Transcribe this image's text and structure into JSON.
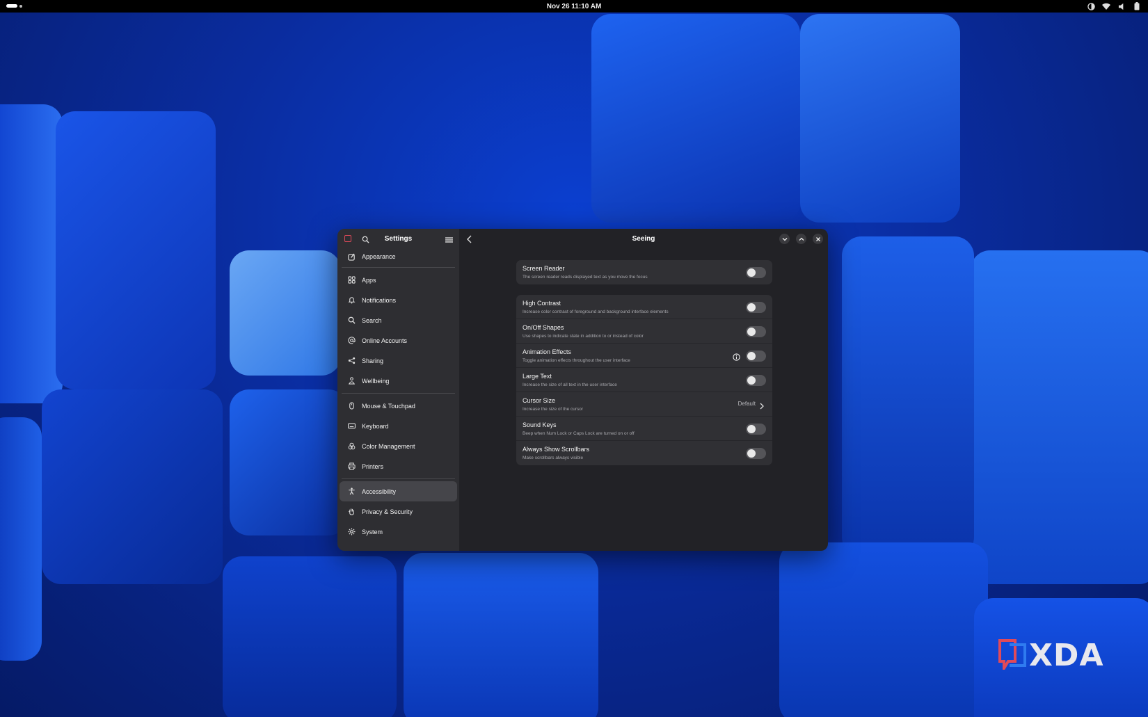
{
  "topbar": {
    "clock": "Nov 26  11:10 AM",
    "tray_icons": [
      "night-light-icon",
      "wifi-icon",
      "volume-icon",
      "battery-icon"
    ]
  },
  "window": {
    "sidebar": {
      "title": "Settings",
      "items": [
        {
          "label": "Appearance",
          "icon": "appearance-icon"
        },
        {
          "label": "Apps",
          "icon": "apps-grid-icon"
        },
        {
          "label": "Notifications",
          "icon": "bell-icon"
        },
        {
          "label": "Search",
          "icon": "search-icon"
        },
        {
          "label": "Online Accounts",
          "icon": "at-icon"
        },
        {
          "label": "Sharing",
          "icon": "share-icon"
        },
        {
          "label": "Wellbeing",
          "icon": "wellbeing-icon"
        },
        {
          "label": "Mouse & Touchpad",
          "icon": "mouse-icon"
        },
        {
          "label": "Keyboard",
          "icon": "keyboard-icon"
        },
        {
          "label": "Color Management",
          "icon": "color-icon"
        },
        {
          "label": "Printers",
          "icon": "printer-icon"
        },
        {
          "label": "Accessibility",
          "icon": "accessibility-icon",
          "active": true
        },
        {
          "label": "Privacy & Security",
          "icon": "hand-icon"
        },
        {
          "label": "System",
          "icon": "gear-icon"
        }
      ]
    },
    "main": {
      "title": "Seeing",
      "screen_reader": {
        "title": "Screen Reader",
        "subtitle": "The screen reader reads displayed text as you move the focus",
        "enabled": false
      },
      "settings": [
        {
          "title": "High Contrast",
          "subtitle": "Increase color contrast of foreground and background interface elements",
          "enabled": false
        },
        {
          "title": "On/Off Shapes",
          "subtitle": "Use shapes to indicate state in addition to or instead of color",
          "enabled": false
        },
        {
          "title": "Animation Effects",
          "subtitle": "Toggle animation effects throughout the user interface",
          "enabled": false
        },
        {
          "title": "Large Text",
          "subtitle": "Increase the size of all text in the user interface",
          "enabled": false
        },
        {
          "title": "Cursor Size",
          "subtitle": "Increase the size of the cursor",
          "value": "Default"
        },
        {
          "title": "Sound Keys",
          "subtitle": "Beep when Num Lock or Caps Lock are turned on or off",
          "enabled": false
        },
        {
          "title": "Always Show Scrollbars",
          "subtitle": "Make scrollbars always visible",
          "enabled": false
        }
      ]
    }
  },
  "watermark": {
    "text": "XDA"
  },
  "colors": {
    "accent": "#e04a5a",
    "sidebar_bg": "#2e2e32",
    "content_bg": "#222226",
    "row_bg": "#303034"
  }
}
